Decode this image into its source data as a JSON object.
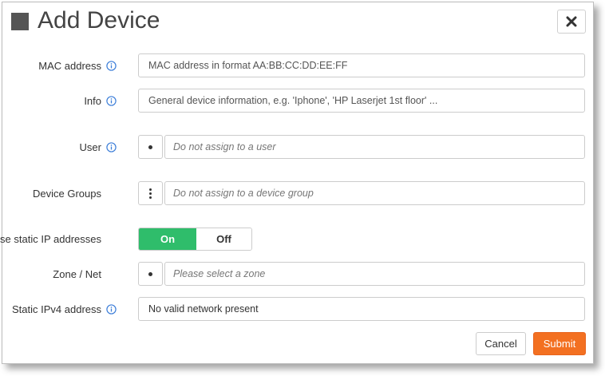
{
  "dialog": {
    "title": "Add Device",
    "close_icon": "close-x-icon"
  },
  "fields": {
    "mac": {
      "label": "MAC address",
      "placeholder": "MAC address in format AA:BB:CC:DD:EE:FF",
      "icon": "info-icon"
    },
    "info": {
      "label": "Info",
      "placeholder": "General device information, e.g. 'Iphone', 'HP Laserjet 1st floor' ...",
      "icon": "info-icon"
    },
    "user": {
      "label": "User",
      "placeholder": "Do not assign to a user",
      "icon": "info-icon",
      "picker_icon": "dot-icon"
    },
    "device_groups": {
      "label": "Device Groups",
      "placeholder": "Do not assign to a device group",
      "picker_icon": "vertical-dots-icon"
    },
    "static_ip": {
      "label": "Use static IP addresses",
      "on_label": "On",
      "off_label": "Off",
      "selected": "On"
    },
    "zone": {
      "label": "Zone / Net",
      "placeholder": "Please select a zone",
      "picker_icon": "dot-icon"
    },
    "ipv4": {
      "label": "Static IPv4 address",
      "value": "No valid network present",
      "icon": "info-icon"
    }
  },
  "footer": {
    "cancel_label": "Cancel",
    "submit_label": "Submit"
  },
  "colors": {
    "accent_submit": "#f37021",
    "toggle_on": "#2fbd6b",
    "info_icon": "#3b7dd8"
  }
}
